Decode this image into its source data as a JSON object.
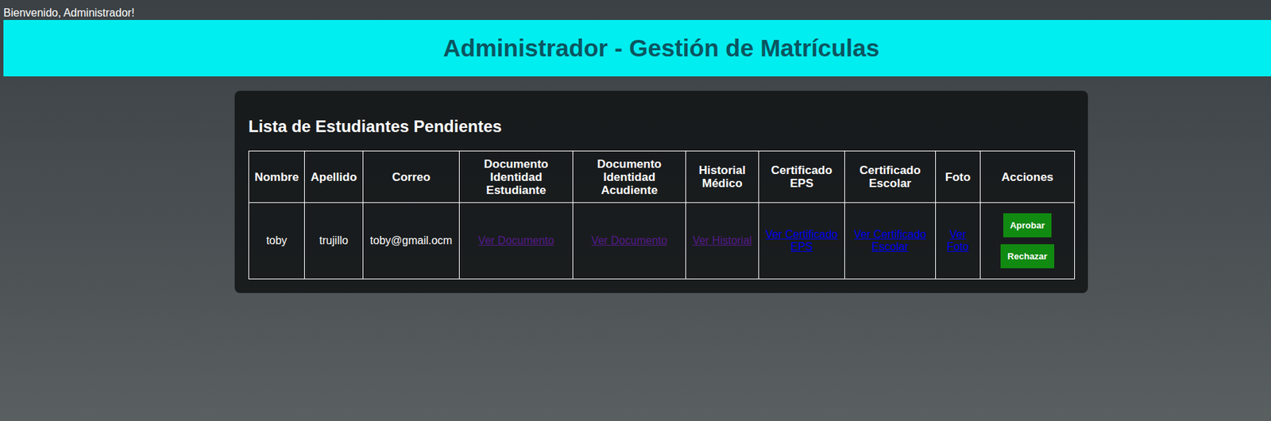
{
  "welcome": "Bienvenido, Administrador!",
  "header": {
    "title": "Administrador - Gestión de Matrículas"
  },
  "panel": {
    "title": "Lista de Estudiantes Pendientes"
  },
  "table": {
    "columns": [
      "Nombre",
      "Apellido",
      "Correo",
      "Documento Identidad Estudiante",
      "Documento Identidad Acudiente",
      "Historial Médico",
      "Certificado EPS",
      "Certificado Escolar",
      "Foto",
      "Acciones"
    ],
    "rows": [
      {
        "cells": [
          {
            "kind": "text",
            "text": "toby"
          },
          {
            "kind": "text",
            "text": "trujillo"
          },
          {
            "kind": "text",
            "text": "toby@gmail.ocm"
          },
          {
            "kind": "link",
            "text": "Ver Documento",
            "visited": true
          },
          {
            "kind": "link",
            "text": "Ver Documento",
            "visited": true
          },
          {
            "kind": "link",
            "text": "Ver Historial",
            "visited": true
          },
          {
            "kind": "link",
            "text": "Ver Certificado EPS",
            "visited": false
          },
          {
            "kind": "link",
            "text": "Ver Certificado Escolar",
            "visited": false
          },
          {
            "kind": "link",
            "text": "Ver Foto",
            "visited": false
          },
          {
            "kind": "actions",
            "buttons": [
              "Aprobar",
              "Rechazar"
            ]
          }
        ]
      }
    ]
  }
}
